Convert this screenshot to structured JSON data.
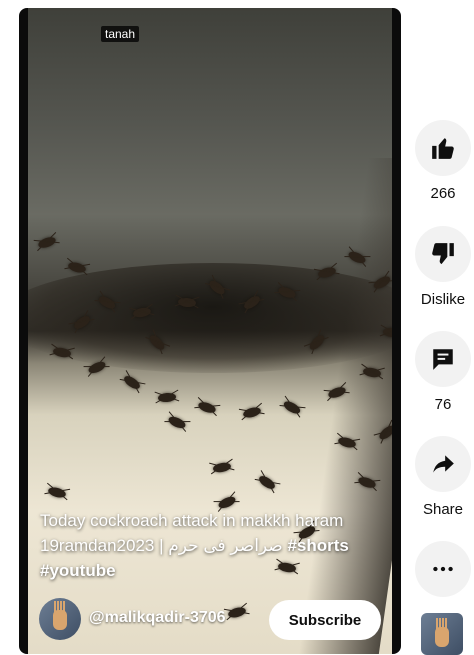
{
  "video": {
    "watermark": "tanah",
    "caption": {
      "line1": "Today cockroach attack in makkh haram",
      "line2_prefix": "19ramdan2023 | ",
      "line2_arabic": "صراصر فی حرم",
      "line2_hashtag": " #shorts",
      "line3_hashtag": "#youtube"
    },
    "channel": {
      "handle": "@malikqadir-3706",
      "avatar_icon": "raised-hand-avatar"
    },
    "subscribe_label": "Subscribe"
  },
  "actions": {
    "like": {
      "icon": "thumbs-up-icon",
      "label": "266"
    },
    "dislike": {
      "icon": "thumbs-down-icon",
      "label": "Dislike"
    },
    "comments": {
      "icon": "comment-icon",
      "label": "76"
    },
    "share": {
      "icon": "share-arrow-icon",
      "label": "Share"
    },
    "more": {
      "icon": "more-horizontal-icon"
    }
  },
  "colors": {
    "action_bg": "#f2f2f2",
    "icon": "#0f0f0f",
    "subscribe_bg": "#ffffff"
  }
}
